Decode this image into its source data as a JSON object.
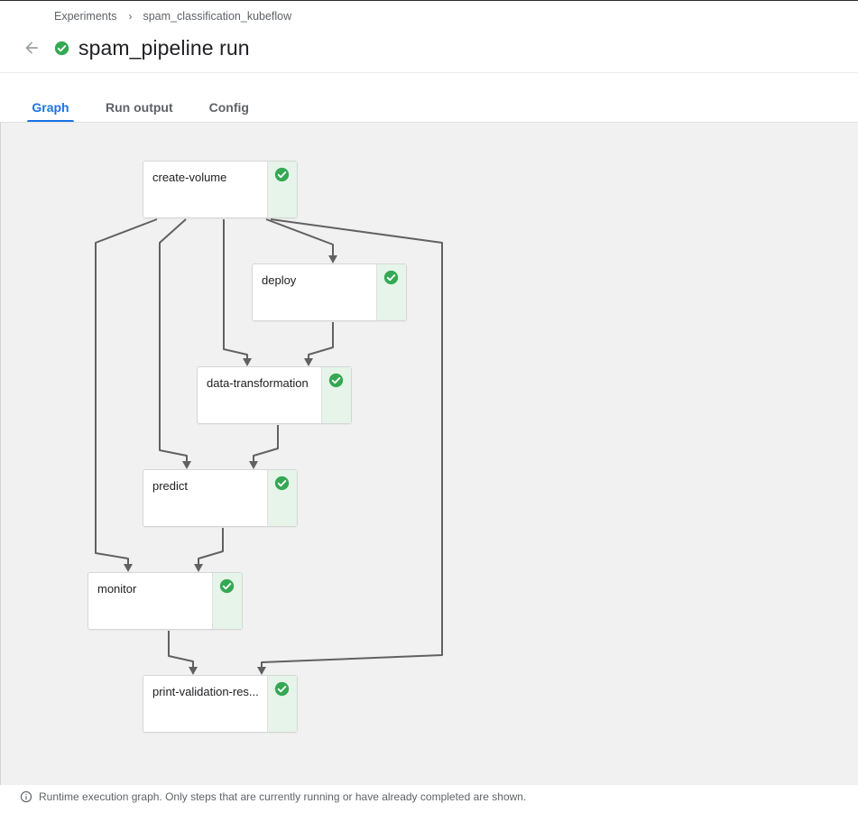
{
  "breadcrumb": {
    "items": [
      "Experiments",
      "spam_classification_kubeflow"
    ],
    "separator": "›"
  },
  "header": {
    "title": "spam_pipeline run",
    "status": "success"
  },
  "tabs": [
    {
      "label": "Graph",
      "active": true
    },
    {
      "label": "Run output",
      "active": false
    },
    {
      "label": "Config",
      "active": false
    }
  ],
  "graph": {
    "nodes": [
      {
        "id": "create-volume",
        "label": "create-volume",
        "status": "succeeded"
      },
      {
        "id": "deploy",
        "label": "deploy",
        "status": "succeeded"
      },
      {
        "id": "data-transformation",
        "label": "data-transformation",
        "status": "succeeded"
      },
      {
        "id": "predict",
        "label": "predict",
        "status": "succeeded"
      },
      {
        "id": "monitor",
        "label": "monitor",
        "status": "succeeded"
      },
      {
        "id": "print-validation-res",
        "label": "print-validation-res...",
        "status": "succeeded"
      }
    ],
    "edges": [
      [
        "create-volume",
        "deploy"
      ],
      [
        "create-volume",
        "data-transformation"
      ],
      [
        "deploy",
        "data-transformation"
      ],
      [
        "create-volume",
        "predict"
      ],
      [
        "data-transformation",
        "predict"
      ],
      [
        "create-volume",
        "monitor"
      ],
      [
        "predict",
        "monitor"
      ],
      [
        "monitor",
        "print-validation-res"
      ],
      [
        "create-volume",
        "print-validation-res"
      ]
    ]
  },
  "footer": {
    "note": "Runtime execution graph. Only steps that are currently running or have already completed are shown."
  },
  "colors": {
    "accent": "#1a73e8",
    "success": "#34a853",
    "success_bg": "#e6f4ea",
    "edge": "#616161"
  }
}
